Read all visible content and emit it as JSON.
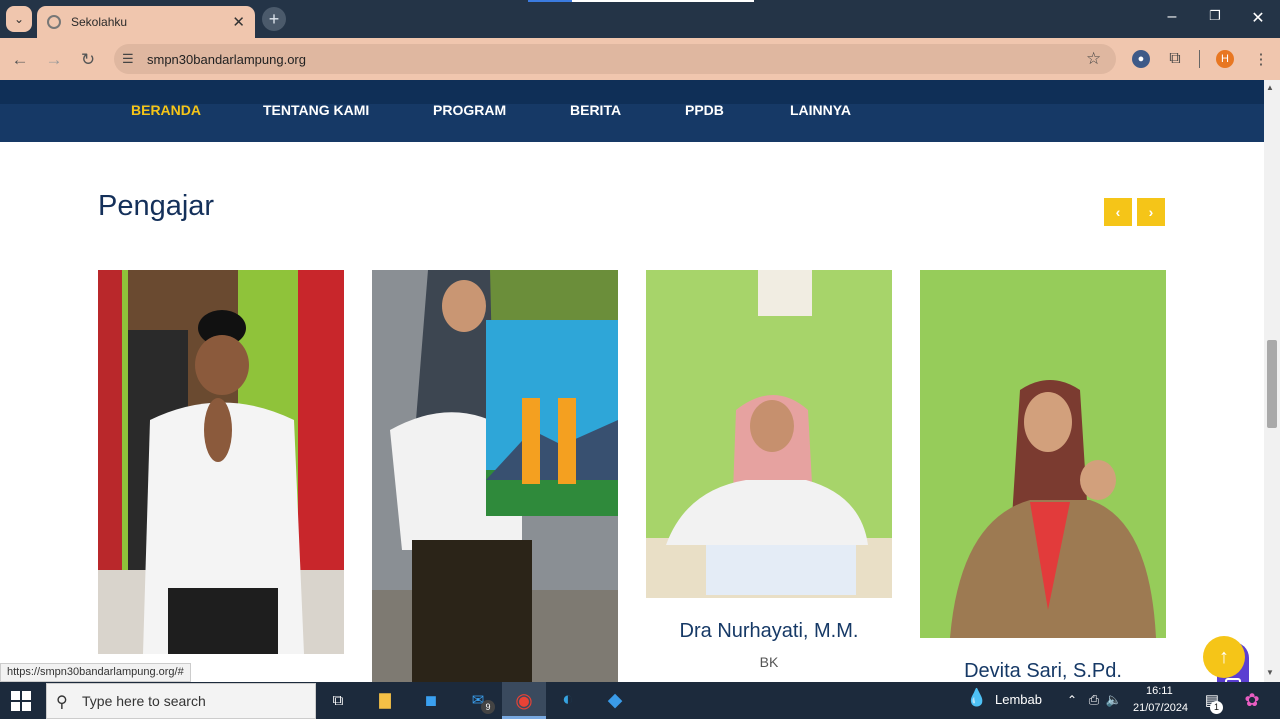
{
  "browser": {
    "tab_title": "Sekolahku",
    "url": "smpn30bandarlampung.org",
    "status_url": "https://smpn30bandarlampung.org/#",
    "profile_initial": "H"
  },
  "nav": {
    "items": [
      "BERANDA",
      "TENTANG KAMI",
      "PROGRAM",
      "BERITA",
      "PPDB",
      "LAINNYA"
    ],
    "active": "BERANDA"
  },
  "section": {
    "title": "Pengajar",
    "prev": "‹",
    "next": "›"
  },
  "teachers": [
    {
      "name": "",
      "role": ""
    },
    {
      "name": "",
      "role": ""
    },
    {
      "name": "Dra Nurhayati, M.M.",
      "role": "BK"
    },
    {
      "name": "Devita Sari, S.Pd.",
      "role": ""
    }
  ],
  "taskbar": {
    "search_placeholder": "Type here to search",
    "mail_badge": "9",
    "weather": "Lembab",
    "time": "16:11",
    "date": "21/07/2024",
    "notif_badge": "1"
  },
  "colors": {
    "navbar": "#163966",
    "accent": "#f5c518",
    "heading": "#14305a"
  }
}
